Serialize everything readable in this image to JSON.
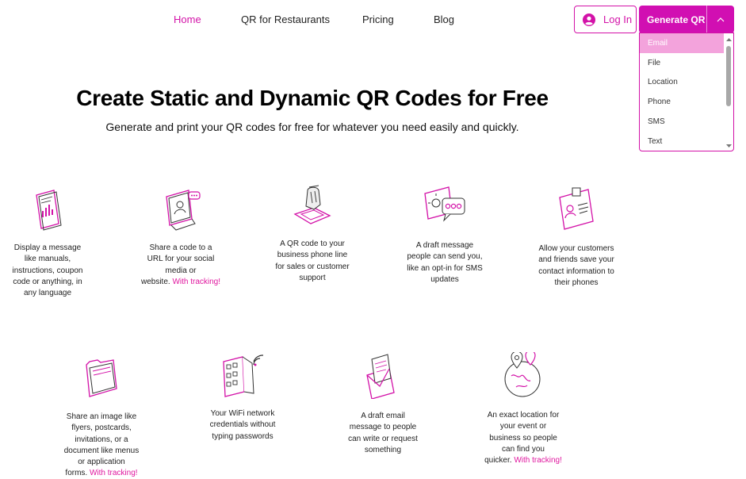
{
  "nav": {
    "links": [
      "Home",
      "QR for Restaurants",
      "Pricing",
      "Blog"
    ]
  },
  "header": {
    "login_label": "Log In",
    "generate_label": "Generate QR"
  },
  "dropdown": {
    "options": [
      "Email",
      "File",
      "Location",
      "Phone",
      "SMS",
      "Text"
    ],
    "selected": "Email"
  },
  "hero": {
    "title": "Create Static and Dynamic QR Codes for Free",
    "subtitle": "Generate and print your QR codes for free for whatever you need easily and quickly."
  },
  "features": [
    {
      "icon": "document-icon",
      "lines": [
        "Display a message",
        "like manuals,",
        "instructions, coupon",
        "code or anything, in",
        "any language"
      ],
      "tracking": ""
    },
    {
      "icon": "social-media-icon",
      "lines": [
        "Share a code to a",
        "URL for your social",
        "media or",
        "website."
      ],
      "tracking": "With tracking!"
    },
    {
      "icon": "phone-hand-icon",
      "lines": [
        "A QR code  to your",
        "business phone line",
        "for sales or customer",
        "support"
      ],
      "tracking": ""
    },
    {
      "icon": "sms-bubbles-icon",
      "lines": [
        "A draft message",
        "people can send you,",
        "like an opt-in for SMS",
        "updates"
      ],
      "tracking": ""
    },
    {
      "icon": "contact-card-icon",
      "lines": [
        "Allow your customers",
        "and friends save your",
        "contact information to",
        "their phones"
      ],
      "tracking": ""
    },
    {
      "icon": "folder-icon",
      "lines": [
        "Share an image like",
        "flyers, postcards,",
        "invitations, or a",
        "document like menus",
        "or application",
        "forms."
      ],
      "tracking": "With tracking!"
    },
    {
      "icon": "wifi-building-icon",
      "lines": [
        "Your WiFi network",
        "credentials without",
        "typing passwords"
      ],
      "tracking": ""
    },
    {
      "icon": "envelope-icon",
      "lines": [
        "A draft email",
        "message to people",
        "can write or request",
        "something"
      ],
      "tracking": ""
    },
    {
      "icon": "globe-pin-icon",
      "lines": [
        "An exact location for",
        "your event or",
        "business so people",
        "can find you",
        "quicker."
      ],
      "tracking": "With tracking!"
    }
  ],
  "colors": {
    "brand": "#d10fb2",
    "accent_text": "#e0179f",
    "dropdown_selected": "#f3a3dc"
  }
}
